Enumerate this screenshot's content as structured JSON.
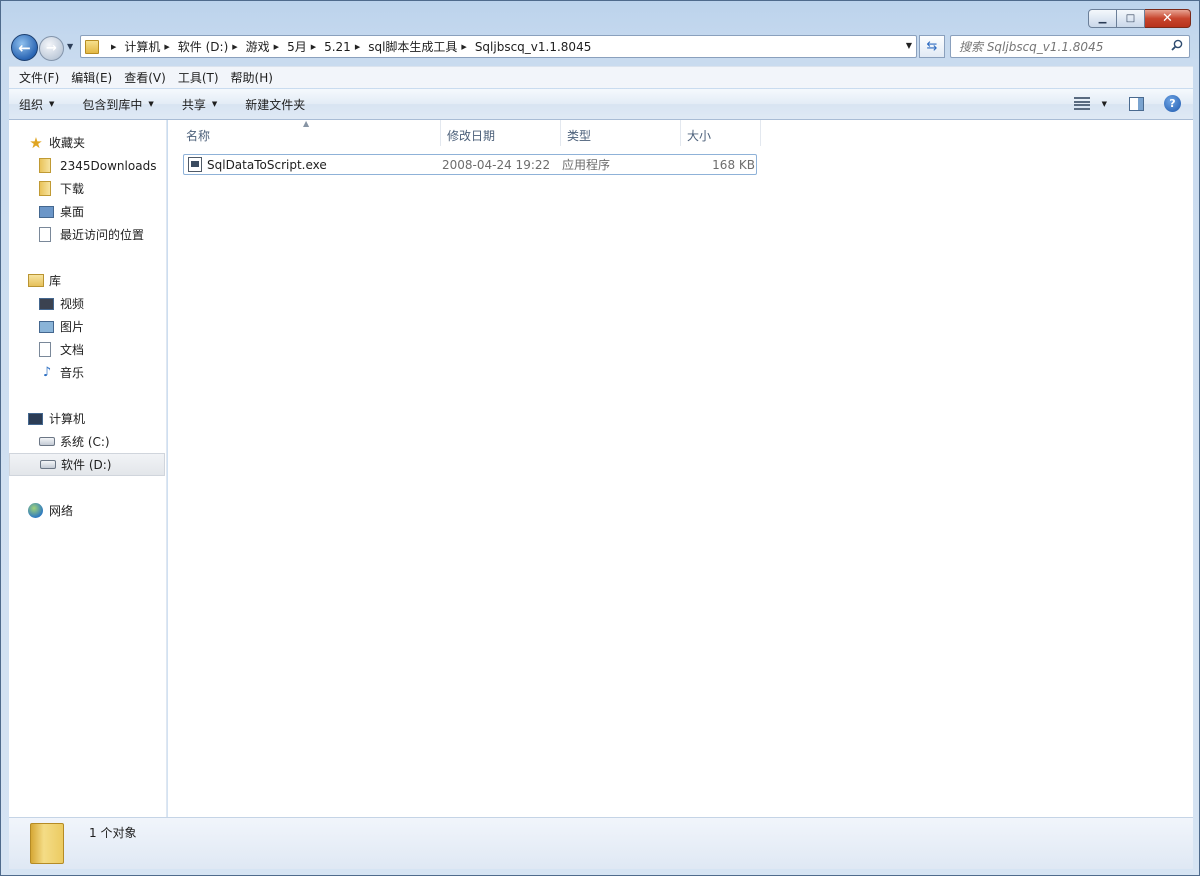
{
  "window": {
    "caption_buttons": {
      "minimize": "▁",
      "maximize": "□",
      "close": "✕"
    }
  },
  "nav": {
    "back_glyph": "←",
    "forward_glyph": "→",
    "breadcrumbs": [
      "计算机",
      "软件 (D:)",
      "游戏",
      "5月",
      "5.21",
      "sql脚本生成工具",
      "Sqljbscq_v1.1.8045"
    ],
    "search_placeholder": "搜索 Sqljbscq_v1.1.8045"
  },
  "menu": {
    "items": [
      "文件(F)",
      "编辑(E)",
      "查看(V)",
      "工具(T)",
      "帮助(H)"
    ]
  },
  "toolbar": {
    "organize": "组织",
    "include_in_library": "包含到库中",
    "share": "共享",
    "new_folder": "新建文件夹",
    "help_glyph": "?"
  },
  "sidebar": {
    "favorites": {
      "label": "收藏夹",
      "icon": "star-icon",
      "items": [
        "2345Downloads",
        "下载",
        "桌面",
        "最近访问的位置"
      ]
    },
    "libraries": {
      "label": "库",
      "icon": "library-icon",
      "items": [
        "视频",
        "图片",
        "文档",
        "音乐"
      ]
    },
    "computer": {
      "label": "计算机",
      "icon": "computer-icon",
      "items": [
        "系统 (C:)",
        "软件 (D:)"
      ],
      "selected": "软件 (D:)"
    },
    "network": {
      "label": "网络",
      "icon": "network-icon"
    }
  },
  "file_list": {
    "columns": [
      "名称",
      "修改日期",
      "类型",
      "大小"
    ],
    "rows": [
      {
        "name": "SqlDataToScript.exe",
        "modified": "2008-04-24 19:22",
        "type": "应用程序",
        "size": "168 KB"
      }
    ]
  },
  "details": {
    "status": "1 个对象"
  },
  "colors": {
    "accent": "#2b66b4",
    "selection_border": "#8fb2d8",
    "frame": "#c9dbef"
  }
}
